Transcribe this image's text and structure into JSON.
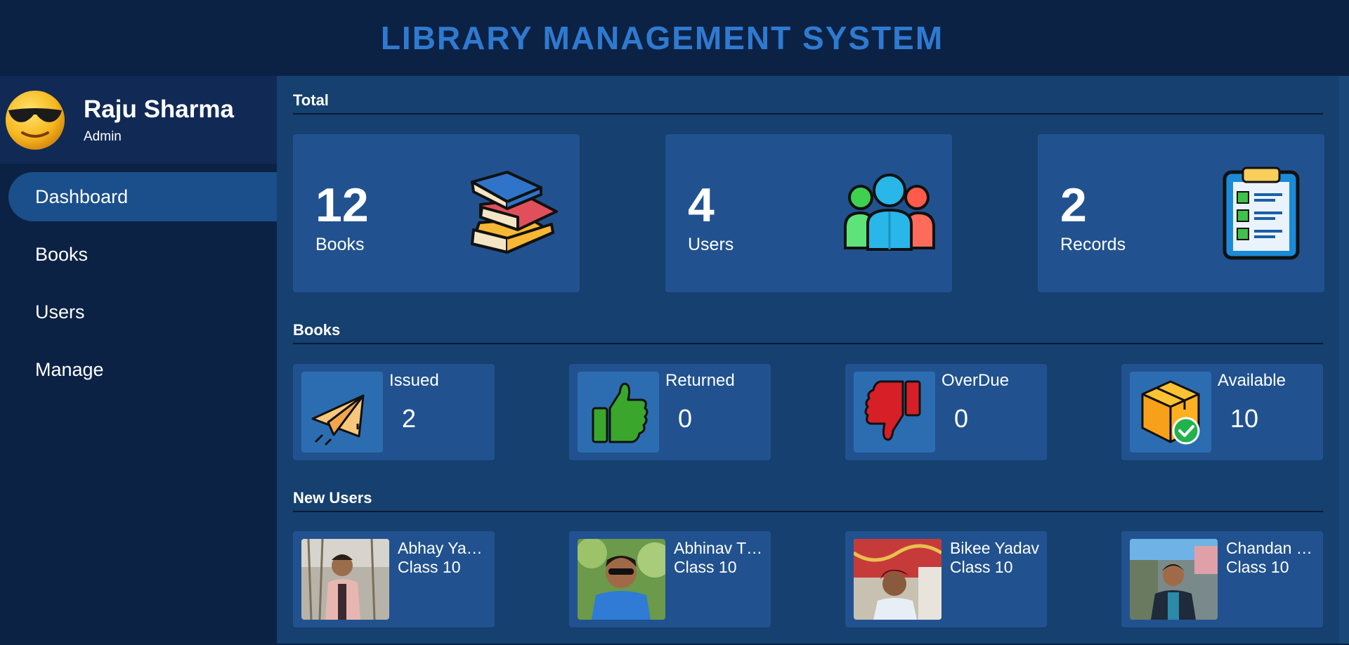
{
  "header": {
    "title": "LIBRARY MANAGEMENT SYSTEM"
  },
  "profile": {
    "name": "Raju Sharma",
    "role": "Admin",
    "avatar_icon": "sunglasses-emoji-icon"
  },
  "nav": [
    {
      "label": "Dashboard",
      "active": true
    },
    {
      "label": "Books",
      "active": false
    },
    {
      "label": "Users",
      "active": false
    },
    {
      "label": "Manage",
      "active": false
    }
  ],
  "total": {
    "title": "Total",
    "cards": [
      {
        "value": "12",
        "label": "Books",
        "icon": "books-stack-icon"
      },
      {
        "value": "4",
        "label": "Users",
        "icon": "users-group-icon"
      },
      {
        "value": "2",
        "label": "Records",
        "icon": "clipboard-checklist-icon"
      }
    ]
  },
  "books": {
    "title": "Books",
    "cards": [
      {
        "label": "Issued",
        "value": "2",
        "icon": "paper-plane-icon"
      },
      {
        "label": "Returned",
        "value": "0",
        "icon": "thumbs-up-icon"
      },
      {
        "label": "OverDue",
        "value": "0",
        "icon": "thumbs-down-icon"
      },
      {
        "label": "Available",
        "value": "10",
        "icon": "box-check-icon"
      }
    ]
  },
  "new_users": {
    "title": "New Users",
    "users": [
      {
        "name": "Abhay Ya…",
        "class": "Class 10"
      },
      {
        "name": "Abhinav T…",
        "class": "Class 10"
      },
      {
        "name": "Bikee Yadav",
        "class": "Class 10"
      },
      {
        "name": "Chandan …",
        "class": "Class 10"
      }
    ]
  },
  "colors": {
    "header_bg": "#0b2245",
    "title": "#2f7ad0",
    "main_bg": "#15406f",
    "card_bg": "#21528f",
    "active_nav": "#1a4f8c"
  }
}
